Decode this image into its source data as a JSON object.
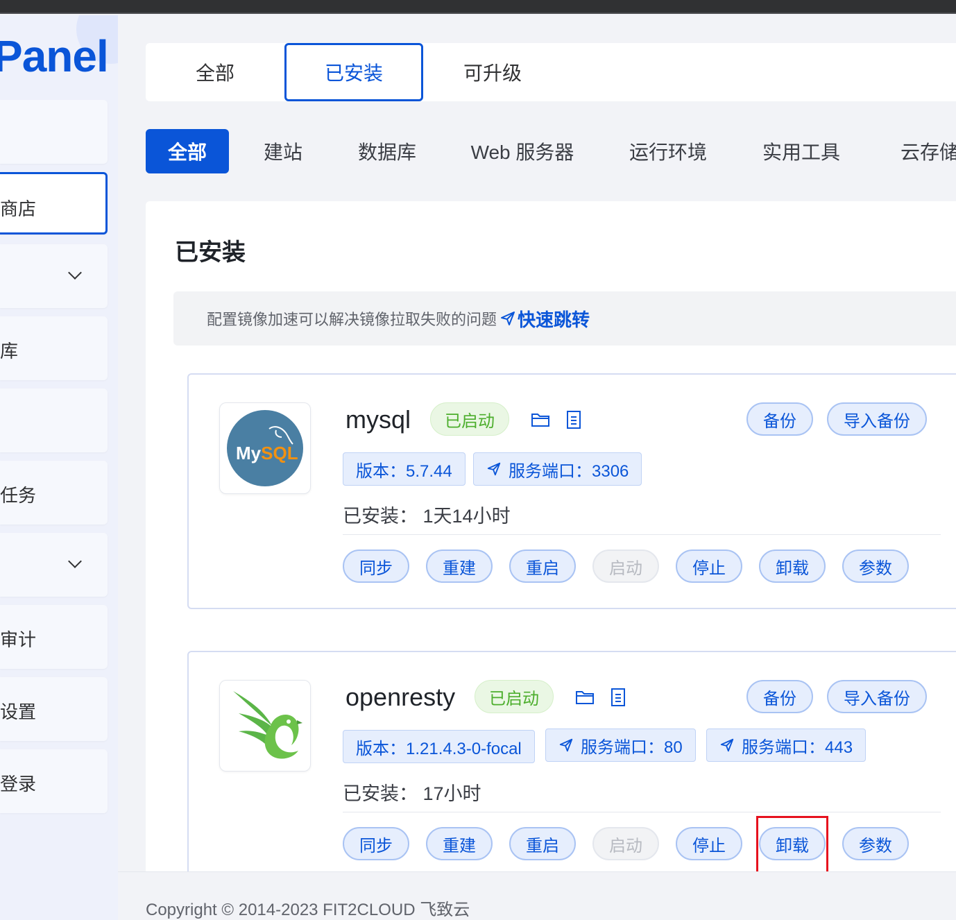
{
  "app": {
    "logo_text": "Panel",
    "brand_color": "#0a55d8"
  },
  "sidebar": {
    "items": [
      {
        "label": "",
        "has_chevron": false
      },
      {
        "label": "商店",
        "active": true
      },
      {
        "label": "",
        "has_chevron": true
      },
      {
        "label": "库"
      },
      {
        "label": ""
      },
      {
        "label": "任务"
      },
      {
        "label": "",
        "has_chevron": true
      },
      {
        "label": "审计"
      },
      {
        "label": "设置"
      },
      {
        "label": "登录"
      }
    ]
  },
  "tabs": [
    {
      "label": "全部"
    },
    {
      "label": "已安装",
      "active": true
    },
    {
      "label": "可升级"
    }
  ],
  "categories": [
    {
      "label": "全部",
      "active": true
    },
    {
      "label": "建站"
    },
    {
      "label": "数据库"
    },
    {
      "label": "Web 服务器"
    },
    {
      "label": "运行环境"
    },
    {
      "label": "实用工具"
    },
    {
      "label": "云存储"
    }
  ],
  "panel": {
    "title": "已安装",
    "notice_text": "配置镜像加速可以解决镜像拉取失败的问题",
    "notice_link": "快速跳转"
  },
  "apps": [
    {
      "name": "mysql",
      "status": "已启动",
      "version_tag": "版本：5.7.44",
      "port_tags": [
        "服务端口：3306"
      ],
      "installed_label": "已安装：",
      "installed_value": "1天14小时",
      "logo_text": "MySQL",
      "backup_label": "备份",
      "import_backup_label": "导入备份",
      "actions": [
        "同步",
        "重建",
        "重启",
        "启动",
        "停止",
        "卸载",
        "参数"
      ]
    },
    {
      "name": "openresty",
      "status": "已启动",
      "version_tag": "版本：1.21.4.3-0-focal",
      "port_tags": [
        "服务端口：80",
        "服务端口：443"
      ],
      "installed_label": "已安装：",
      "installed_value": "17小时",
      "backup_label": "备份",
      "import_backup_label": "导入备份",
      "actions": [
        "同步",
        "重建",
        "重启",
        "启动",
        "停止",
        "卸载",
        "参数"
      ]
    }
  ],
  "footer": {
    "copyright": "Copyright © 2014-2023 FIT2CLOUD 飞致云"
  }
}
